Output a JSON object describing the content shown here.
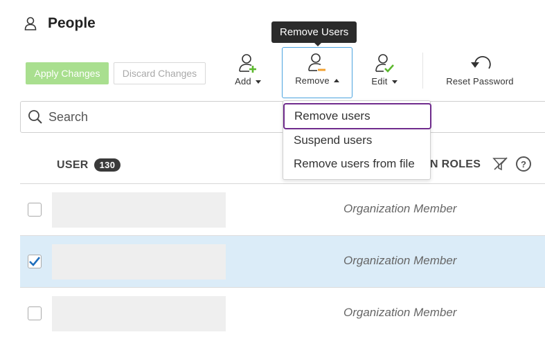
{
  "page": {
    "title": "People"
  },
  "actions": {
    "apply_label": "Apply Changes",
    "discard_label": "Discard Changes"
  },
  "toolbar": {
    "add_label": "Add",
    "remove_label": "Remove",
    "edit_label": "Edit",
    "reset_password_label": "Reset Password"
  },
  "tooltip": {
    "text": "Remove Users"
  },
  "search": {
    "placeholder": "Search"
  },
  "table": {
    "user_column": "USER",
    "user_count": "130",
    "roles_column": "N ROLES",
    "rows": [
      {
        "role": "Organization Member",
        "checked": false
      },
      {
        "role": "Organization Member",
        "checked": true
      },
      {
        "role": "Organization Member",
        "checked": false
      }
    ]
  },
  "remove_menu": {
    "items": [
      "Remove users",
      "Suspend users",
      "Remove users from file"
    ]
  },
  "colors": {
    "apply_bg": "#a9df8f",
    "selected_row": "#dbecf8",
    "focus_border": "#4aa3df",
    "menu_highlight": "#6f2b8c",
    "add_green": "#5cb82e",
    "remove_orange": "#f0a030",
    "check_blue": "#1f6fbd"
  },
  "icons": [
    "person-icon",
    "add-user-icon",
    "remove-user-icon",
    "edit-user-icon",
    "reset-password-icon",
    "search-icon",
    "filter-icon",
    "help-icon",
    "checkmark-icon"
  ]
}
